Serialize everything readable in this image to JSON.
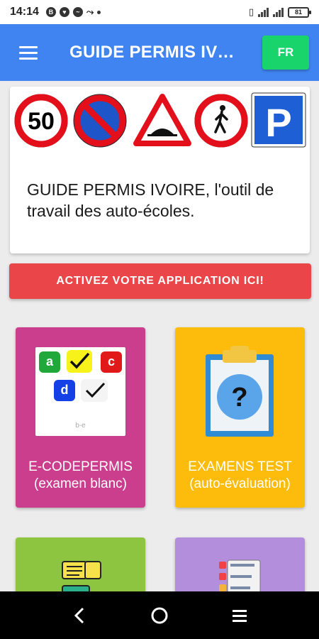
{
  "status_bar": {
    "time": "14:14",
    "battery": "81"
  },
  "app_bar": {
    "title": "GUIDE PERMIS IVOIRE",
    "language_button": "FR"
  },
  "intro": {
    "signs": [
      "50",
      "no-parking-sign",
      "speed-bump-warning-sign",
      "no-pedestrians-sign",
      "P"
    ],
    "text": "GUIDE PERMIS IVOIRE, l'outil de travail des auto-écoles."
  },
  "activate_button": "ACTIVEZ VOTRE APPLICATION ICI!",
  "tiles": [
    {
      "label_line1": "E-CODEPERMIS",
      "label_line2": "(examen blanc)",
      "color": "#cb3e8e",
      "image": {
        "options": [
          "a",
          "c",
          "d"
        ],
        "footer": "b-e"
      }
    },
    {
      "label_line1": "EXAMENS TEST",
      "label_line2": "(auto-évaluation)",
      "color": "#fdbc0c",
      "icon": "clipboard-question-icon"
    },
    {
      "color": "#8dc540",
      "icon": "documents-icon"
    },
    {
      "color": "#b28edc",
      "icon": "checklist-icon"
    }
  ],
  "colors": {
    "app_bar": "#3f84f0",
    "language_button": "#18d46a",
    "activate_button": "#ea4649"
  }
}
